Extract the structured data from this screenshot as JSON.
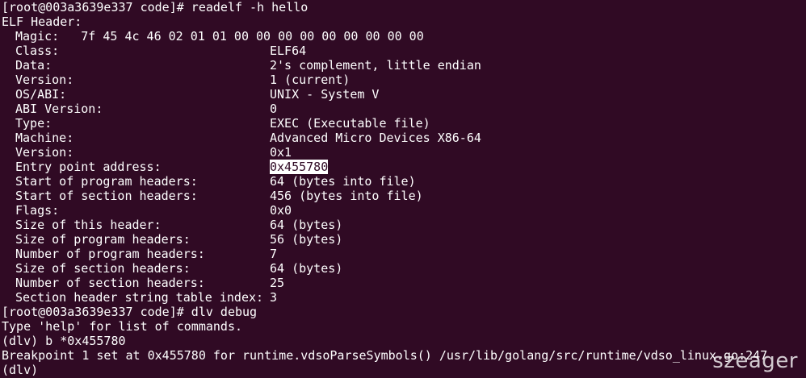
{
  "terminal": {
    "prompt1": "[root@003a3639e337 code]# readelf -h hello",
    "elf_header_title": "ELF Header:",
    "magic_label": "Magic:",
    "magic_value": "7f 45 4c 46 02 01 01 00 00 00 00 00 00 00 00 00",
    "header_rows": [
      {
        "label": "Class:",
        "value": "ELF64"
      },
      {
        "label": "Data:",
        "value": "2's complement, little endian"
      },
      {
        "label": "Version:",
        "value": "1 (current)"
      },
      {
        "label": "OS/ABI:",
        "value": "UNIX - System V"
      },
      {
        "label": "ABI Version:",
        "value": "0"
      },
      {
        "label": "Type:",
        "value": "EXEC (Executable file)"
      },
      {
        "label": "Machine:",
        "value": "Advanced Micro Devices X86-64"
      },
      {
        "label": "Version:",
        "value": "0x1"
      },
      {
        "label": "Entry point address:",
        "value": "0x455780"
      },
      {
        "label": "Start of program headers:",
        "value": "64 (bytes into file)"
      },
      {
        "label": "Start of section headers:",
        "value": "456 (bytes into file)"
      },
      {
        "label": "Flags:",
        "value": "0x0"
      },
      {
        "label": "Size of this header:",
        "value": "64 (bytes)"
      },
      {
        "label": "Size of program headers:",
        "value": "56 (bytes)"
      },
      {
        "label": "Number of program headers:",
        "value": "7"
      },
      {
        "label": "Size of section headers:",
        "value": "64 (bytes)"
      },
      {
        "label": "Number of section headers:",
        "value": "25"
      },
      {
        "label": "Section header string table index:",
        "value": "3"
      }
    ],
    "prompt2": "[root@003a3639e337 code]# dlv debug",
    "help_hint": "Type 'help' for list of commands.",
    "dlv_cmd": "(dlv) b *0x455780",
    "breakpoint_msg": "Breakpoint 1 set at 0x455780 for runtime.vdsoParseSymbols() /usr/lib/golang/src/runtime/vdso_linux.go:247",
    "dlv_prompt": "(dlv)",
    "watermark": "szeager"
  },
  "colors": {
    "background": "#300a24",
    "foreground": "#ffffff"
  }
}
